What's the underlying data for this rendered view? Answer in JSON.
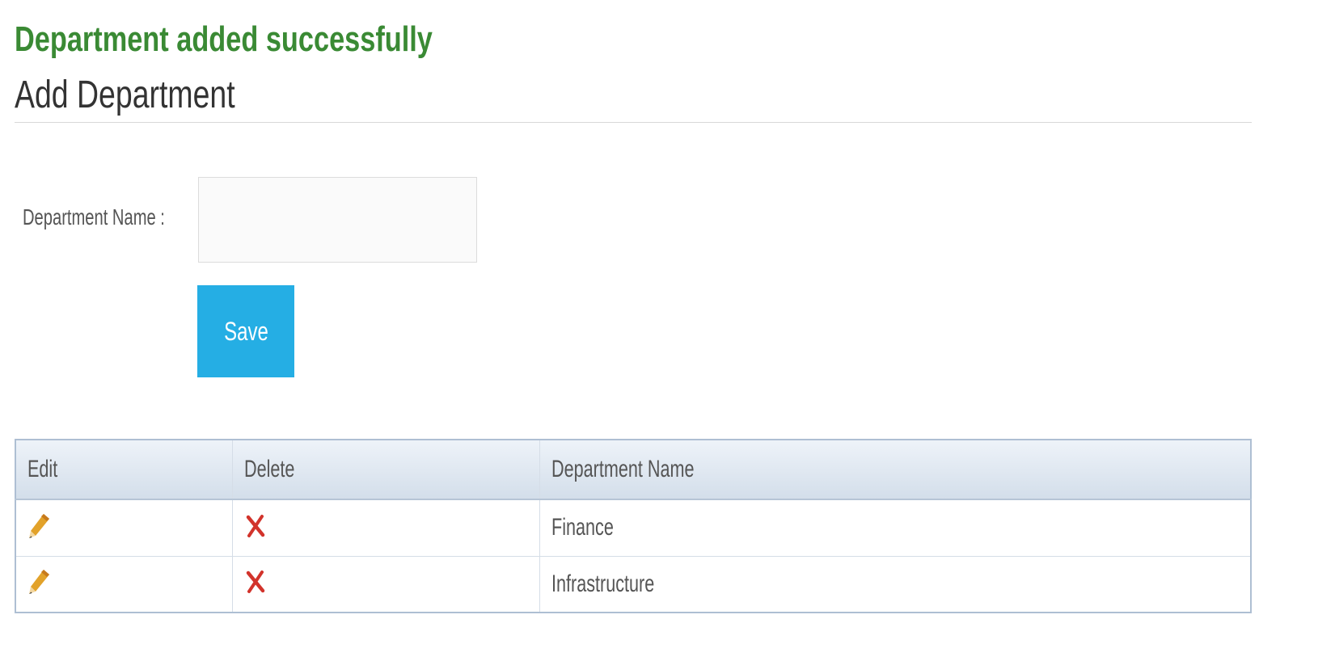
{
  "message": {
    "text": "Department added successfully",
    "color": "#3a8a34"
  },
  "page": {
    "title": "Add Department"
  },
  "form": {
    "department_name_label": "Department Name :",
    "department_name_value": "",
    "save_label": "Save",
    "save_color": "#25aee4"
  },
  "table": {
    "headers": {
      "edit": "Edit",
      "delete": "Delete",
      "department_name": "Department Name"
    },
    "rows": [
      {
        "edit_icon": "pencil-icon",
        "delete_icon": "red-x-icon",
        "department_name": "Finance"
      },
      {
        "edit_icon": "pencil-icon",
        "delete_icon": "red-x-icon",
        "department_name": "Infrastructure"
      }
    ]
  }
}
